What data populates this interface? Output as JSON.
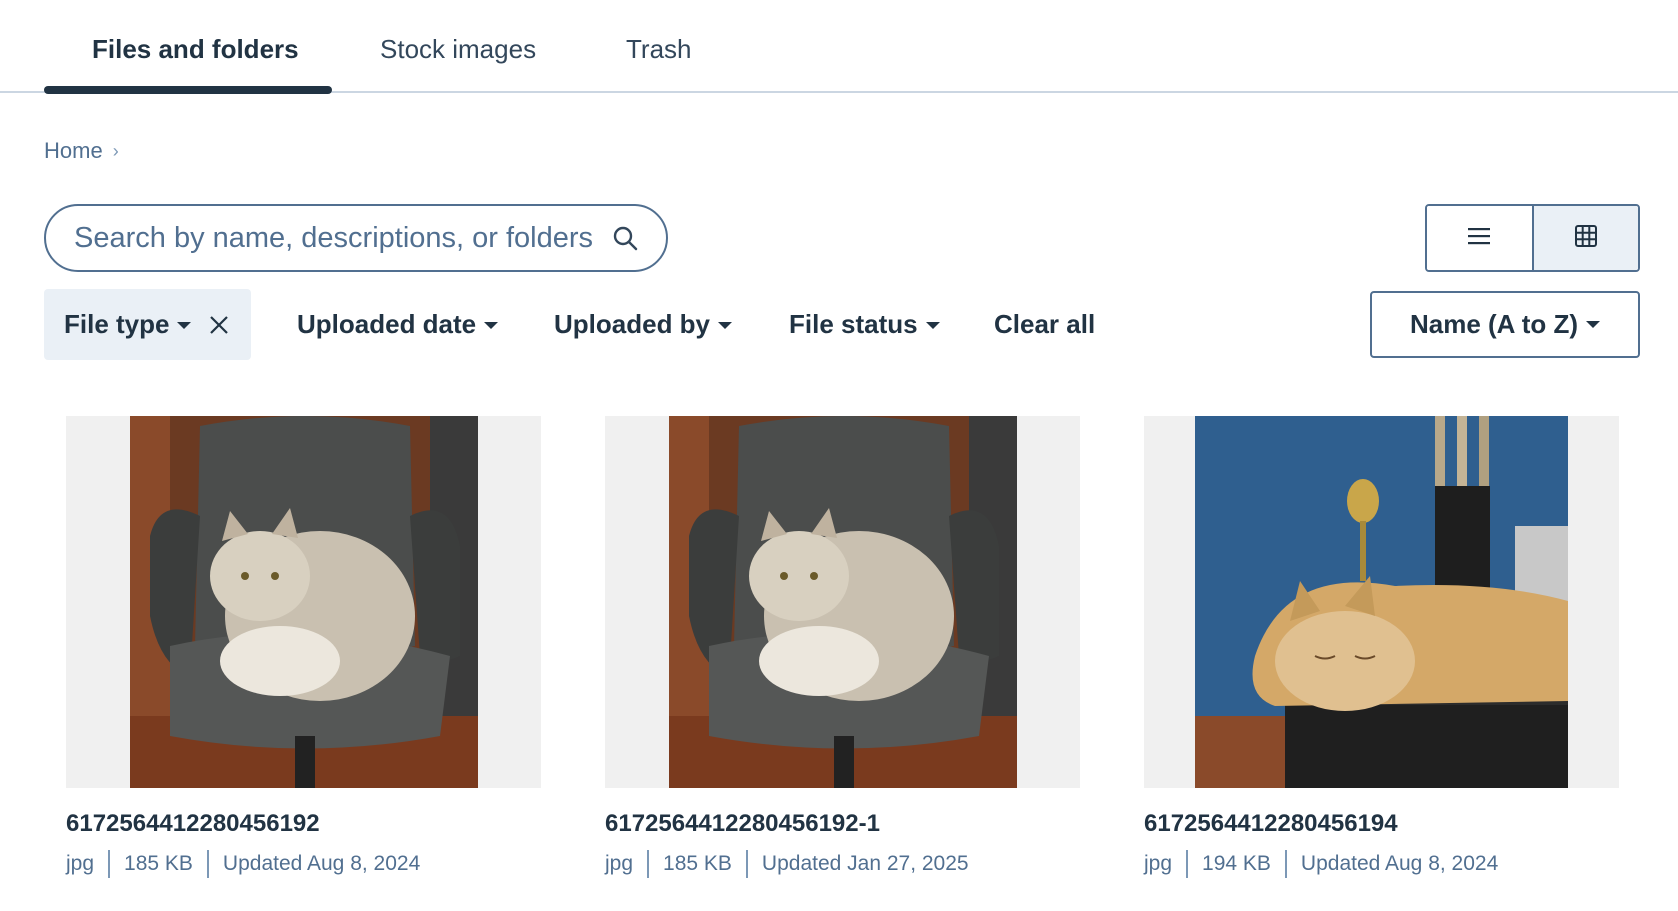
{
  "tabs": [
    {
      "label": "Files and folders",
      "active": true
    },
    {
      "label": "Stock images",
      "active": false
    },
    {
      "label": "Trash",
      "active": false
    }
  ],
  "breadcrumb": {
    "items": [
      "Home"
    ]
  },
  "search": {
    "placeholder": "Search by name, descriptions, or folders",
    "value": ""
  },
  "view_toggle": {
    "selected": "grid",
    "icons": [
      "list-icon",
      "grid-icon"
    ]
  },
  "filters": {
    "file_type": "File type",
    "uploaded_date": "Uploaded date",
    "uploaded_by": "Uploaded by",
    "file_status": "File status",
    "clear_all": "Clear all"
  },
  "sort": {
    "label": "Name (A to Z)"
  },
  "files": [
    {
      "name": "6172564412280456192",
      "type": "jpg",
      "size": "185 KB",
      "updated": "Updated Aug 8, 2024"
    },
    {
      "name": "6172564412280456192-1",
      "type": "jpg",
      "size": "185 KB",
      "updated": "Updated Jan 27, 2025"
    },
    {
      "name": "6172564412280456194",
      "type": "jpg",
      "size": "194 KB",
      "updated": "Updated Aug 8, 2024"
    }
  ],
  "colors": {
    "text_dark": "#213343",
    "text_muted": "#516f90",
    "border": "#516f90",
    "chip_bg": "#eaf0f6",
    "thumb_bg": "#f0f0f0"
  }
}
